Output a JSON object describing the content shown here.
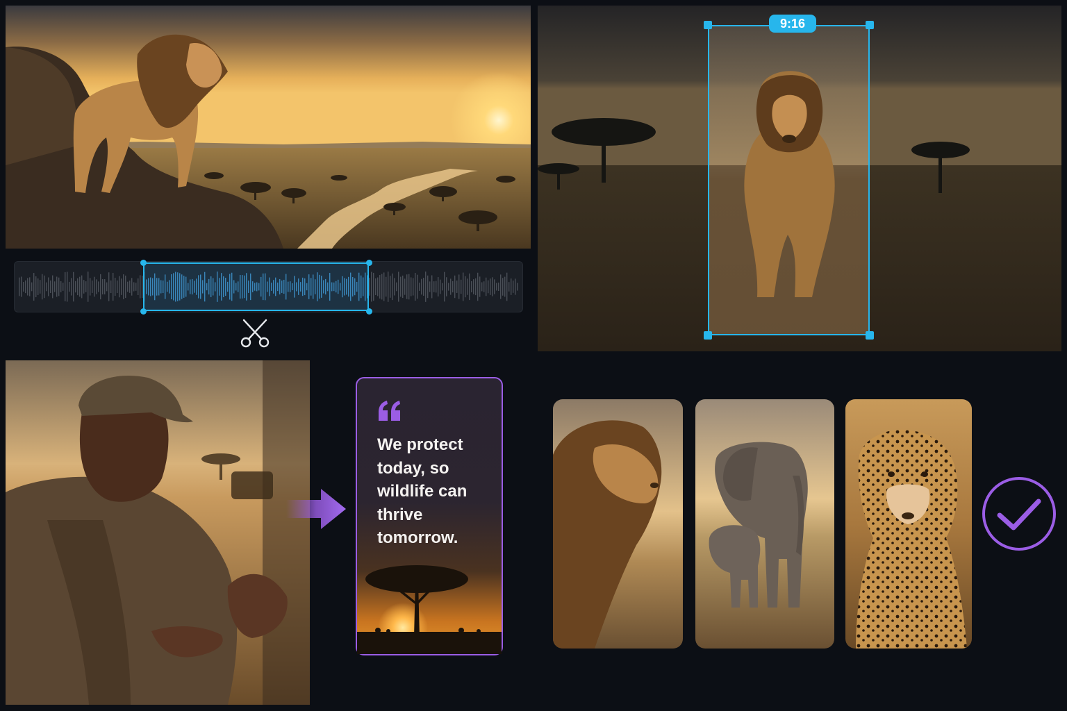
{
  "reframe": {
    "aspect_ratio_label": "9:16"
  },
  "quote": {
    "text": "We protect today, so wildlife can thrive tomorrow."
  },
  "colors": {
    "accent_blue": "#27b6ec",
    "accent_purple": "#9b5de5",
    "background": "#0c0f15"
  },
  "icons": {
    "trim": "scissors-icon",
    "quote": "quote-mark-icon",
    "flow": "arrow-right-icon",
    "done": "check-circle-icon"
  }
}
